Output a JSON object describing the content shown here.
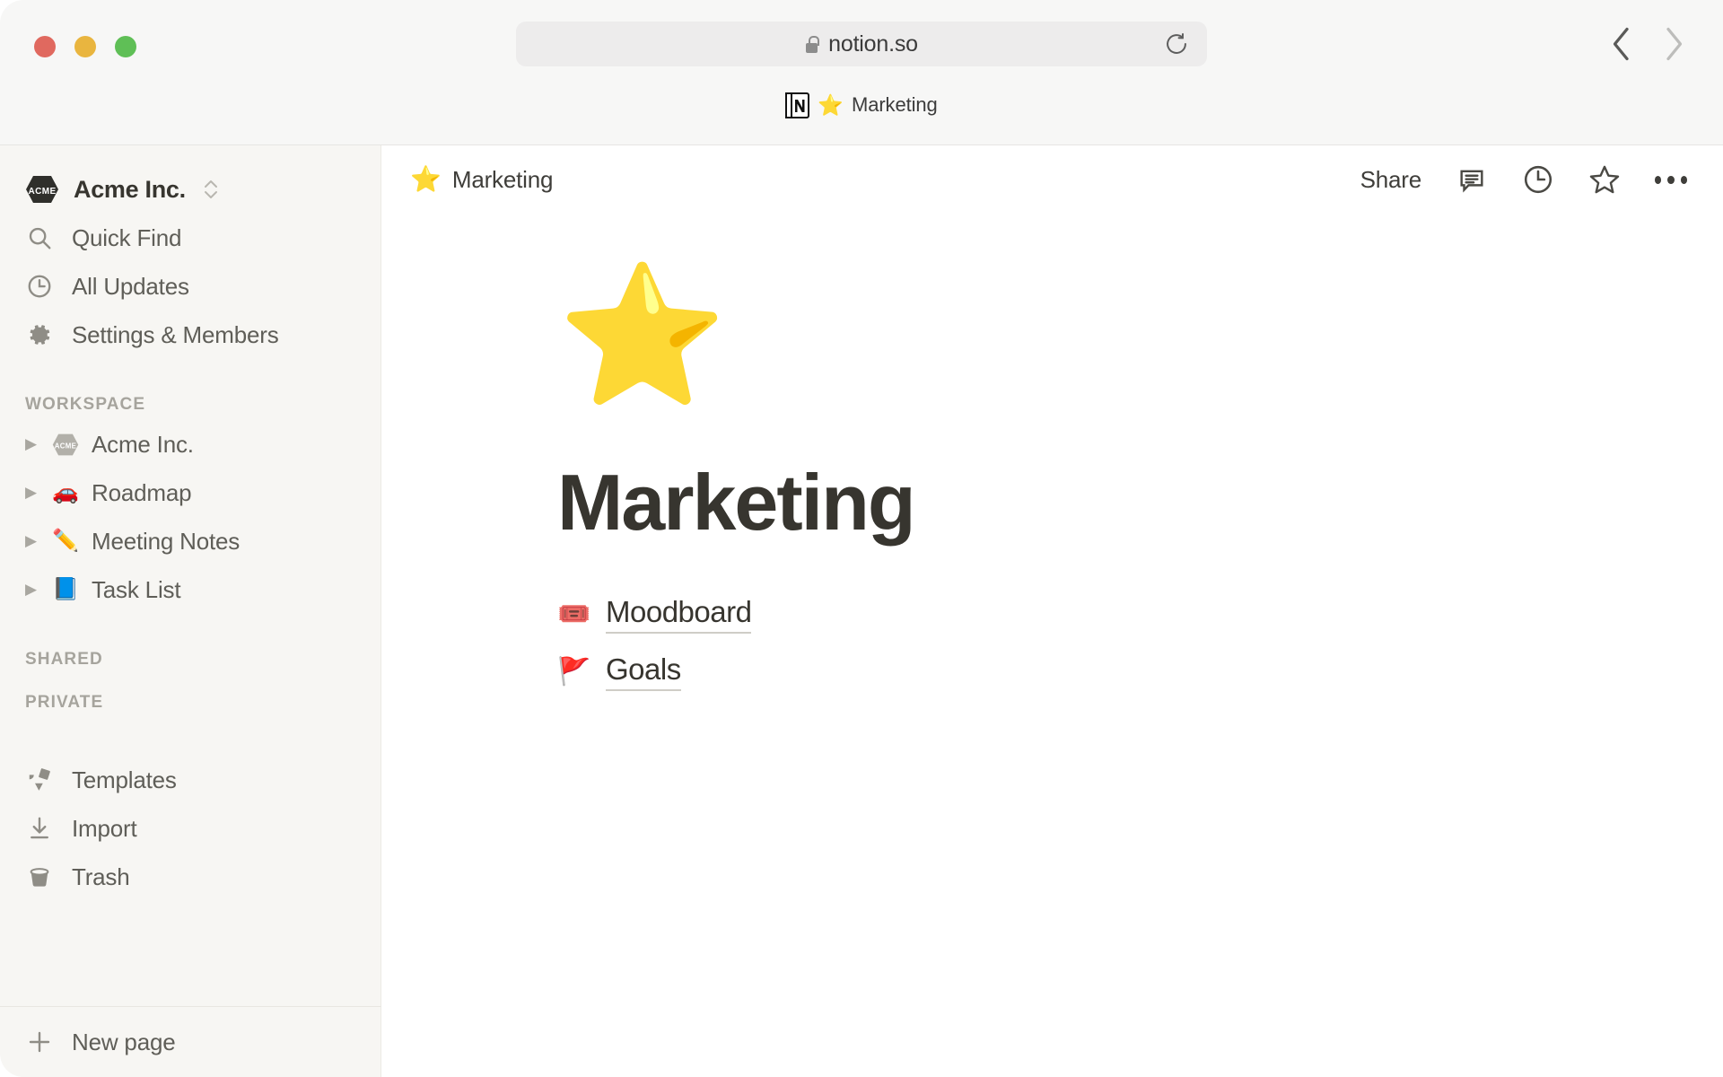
{
  "browser": {
    "traffic_lights": [
      {
        "name": "close",
        "color": "#e0695f"
      },
      {
        "name": "minimize",
        "color": "#e9b53f"
      },
      {
        "name": "maximize",
        "color": "#5fbf56"
      }
    ],
    "url": "notion.so",
    "lock_icon": "lock-icon",
    "reload_icon": "reload-icon",
    "back_icon": "chevron-left-icon",
    "forward_icon": "chevron-right-icon",
    "tab": {
      "favicon": "notion-logo-icon",
      "emoji": "⭐",
      "title": "Marketing"
    }
  },
  "sidebar": {
    "workspace": {
      "name": "Acme Inc.",
      "badge_text": "ACME",
      "switcher_icon": "chevron-up-down-icon"
    },
    "nav": [
      {
        "label": "Quick Find",
        "icon": "search-icon"
      },
      {
        "label": "All Updates",
        "icon": "clock-icon"
      },
      {
        "label": "Settings & Members",
        "icon": "gear-icon"
      }
    ],
    "sections": [
      {
        "label": "WORKSPACE",
        "items": [
          {
            "label": "Acme Inc.",
            "emoji": "",
            "icon": "acme-badge-icon",
            "toggle": "▶"
          },
          {
            "label": "Roadmap",
            "emoji": "🚗",
            "icon": "",
            "toggle": "▶"
          },
          {
            "label": "Meeting Notes",
            "emoji": "✏️",
            "icon": "",
            "toggle": "▶"
          },
          {
            "label": "Task List",
            "emoji": "📘",
            "icon": "",
            "toggle": "▶"
          }
        ]
      },
      {
        "label": "SHARED",
        "items": []
      },
      {
        "label": "PRIVATE",
        "items": []
      }
    ],
    "utility": [
      {
        "label": "Templates",
        "icon": "templates-icon"
      },
      {
        "label": "Import",
        "icon": "import-icon"
      },
      {
        "label": "Trash",
        "icon": "trash-icon"
      }
    ],
    "new_page": {
      "label": "New page",
      "icon": "plus-icon"
    }
  },
  "topbar": {
    "breadcrumb": {
      "emoji": "⭐",
      "title": "Marketing"
    },
    "share_label": "Share",
    "icons": [
      {
        "name": "comment-icon"
      },
      {
        "name": "history-clock-icon"
      },
      {
        "name": "favorite-star-icon"
      },
      {
        "name": "more-options-icon"
      }
    ]
  },
  "page": {
    "emoji": "⭐",
    "title": "Marketing",
    "links": [
      {
        "emoji": "🎟️",
        "label": "Moodboard"
      },
      {
        "emoji": "🚩",
        "label": "Goals"
      }
    ]
  },
  "colors": {
    "sidebar_bg": "#f7f6f3",
    "content_bg": "#ffffff",
    "chrome_bg": "#f7f7f6",
    "text_primary": "#37352f",
    "text_secondary": "#5f5e58",
    "text_muted": "#a6a49d"
  }
}
